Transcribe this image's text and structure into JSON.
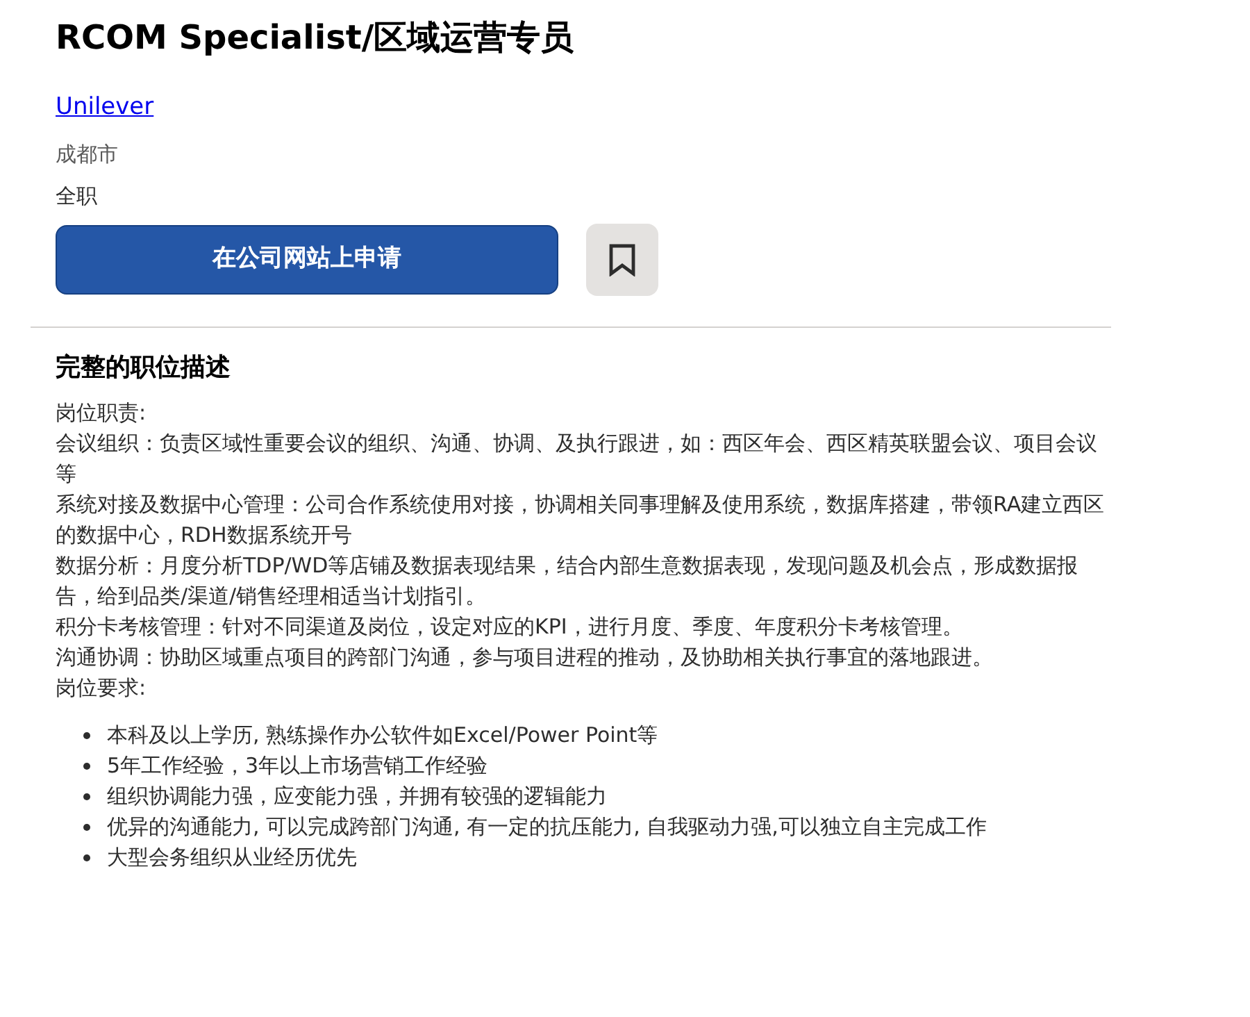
{
  "job": {
    "title": "RCOM Specialist/区域运营专员",
    "company": "Unilever",
    "location": "成都市",
    "type": "全职",
    "apply_button": "在公司网站上申请",
    "saved": false
  },
  "description": {
    "heading": "完整的职位描述",
    "paragraphs": [
      "岗位职责:",
      "会议组织：负责区域性重要会议的组织、沟通、协调、及执行跟进，如：西区年会、西区精英联盟会议、项目会议等",
      "系统对接及数据中心管理：公司合作系统使用对接，协调相关同事理解及使用系统，数据库搭建，带领RA建立西区的数据中心，RDH数据系统开号",
      "数据分析：月度分析TDP/WD等店铺及数据表现结果，结合内部生意数据表现，发现问题及机会点，形成数据报告，给到品类/渠道/销售经理相适当计划指引。",
      "积分卡考核管理：针对不同渠道及岗位，设定对应的KPI，进行月度、季度、年度积分卡考核管理。",
      "沟通协调：协助区域重点项目的跨部门沟通，参与项目进程的推动，及协助相关执行事宜的落地跟进。",
      "岗位要求:"
    ],
    "requirements": [
      "本科及以上学历, 熟练操作办公软件如Excel/Power Point等",
      "5年工作经验，3年以上市场营销工作经验",
      "组织协调能力强，应变能力强，并拥有较强的逻辑能力",
      "优异的沟通能力, 可以完成跨部门沟通, 有一定的抗压能力, 自我驱动力强,可以独立自主完成工作",
      "大型会务组织从业经历优先"
    ]
  }
}
